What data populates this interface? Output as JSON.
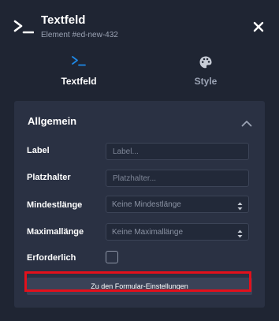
{
  "header": {
    "title": "Textfeld",
    "subtitle": "Element #ed-new-432",
    "icon": "terminal-icon",
    "close_icon": "close-icon"
  },
  "tabs": [
    {
      "label": "Textfeld",
      "icon": "terminal-icon",
      "active": true
    },
    {
      "label": "Style",
      "icon": "palette-icon",
      "active": false
    }
  ],
  "section": {
    "title": "Allgemein",
    "collapse_icon": "chevron-up-icon",
    "fields": {
      "label": {
        "label": "Label",
        "placeholder": "Label...",
        "value": ""
      },
      "placeholder": {
        "label": "Platzhalter",
        "placeholder": "Platzhalter...",
        "value": ""
      },
      "min_length": {
        "label": "Mindestlänge",
        "selected": "Keine Mindestlänge"
      },
      "max_length": {
        "label": "Maximallänge",
        "selected": "Keine Maximallänge"
      },
      "required": {
        "label": "Erforderlich",
        "checked": false
      }
    },
    "settings_button": "Zu den Formular-Einstellungen"
  },
  "colors": {
    "background": "#1f2533",
    "panel": "#2a3143",
    "accent_blue": "#1e88e5",
    "highlight_red": "#e3101b"
  }
}
